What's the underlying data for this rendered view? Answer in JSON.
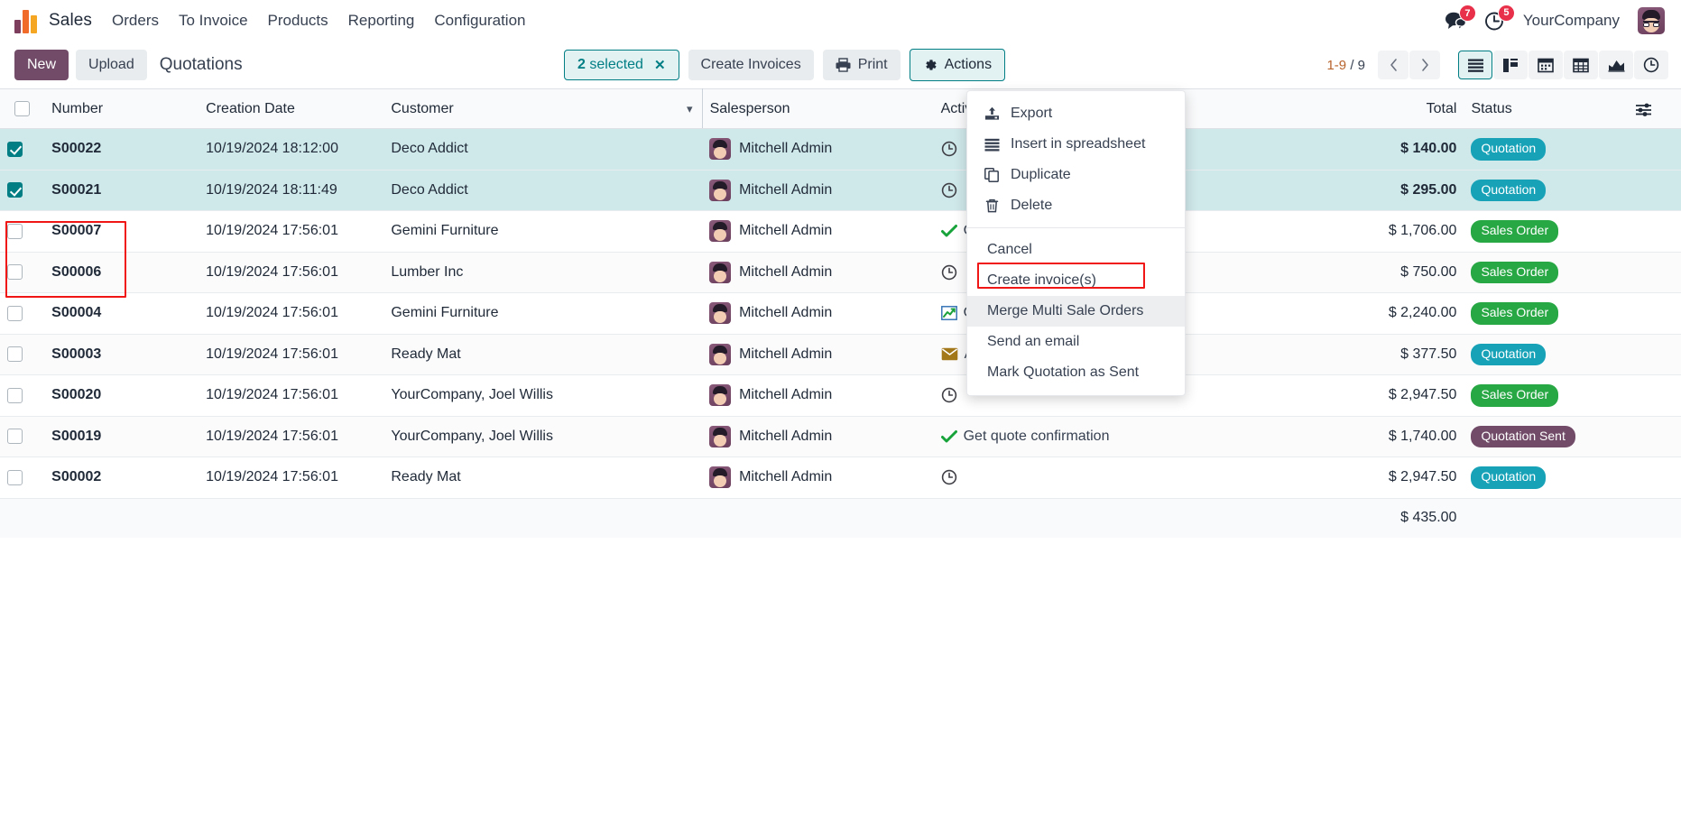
{
  "navbar": {
    "brand": "brand-logo",
    "app_name": "Sales",
    "menu": [
      "Orders",
      "To Invoice",
      "Products",
      "Reporting",
      "Configuration"
    ],
    "messages_count": "7",
    "activities_count": "5",
    "company": "YourCompany"
  },
  "control_panel": {
    "new_label": "New",
    "upload_label": "Upload",
    "view_title": "Quotations",
    "selection": {
      "count": "2",
      "label": "selected",
      "clear": "✕"
    },
    "create_invoices_label": "Create Invoices",
    "print_label": "Print",
    "actions_label": "Actions",
    "pager": {
      "range": "1-9",
      "sep": "/",
      "total": "9"
    },
    "views": [
      {
        "name": "list",
        "active": true
      },
      {
        "name": "kanban",
        "active": false
      },
      {
        "name": "calendar",
        "active": false
      },
      {
        "name": "pivot",
        "active": false
      },
      {
        "name": "graph",
        "active": false
      },
      {
        "name": "activity",
        "active": false
      }
    ]
  },
  "actions_menu": {
    "group1": [
      {
        "label": "Export",
        "icon": "export-icon"
      },
      {
        "label": "Insert in spreadsheet",
        "icon": "spreadsheet-icon"
      },
      {
        "label": "Duplicate",
        "icon": "duplicate-icon"
      },
      {
        "label": "Delete",
        "icon": "trash-icon"
      }
    ],
    "group2": [
      {
        "label": "Cancel",
        "highlighted": false
      },
      {
        "label": "Create invoice(s)",
        "highlighted": false
      },
      {
        "label": "Merge Multi Sale Orders",
        "highlighted": true
      },
      {
        "label": "Send an email",
        "highlighted": false
      },
      {
        "label": "Mark Quotation as Sent",
        "highlighted": false
      }
    ]
  },
  "table": {
    "columns": [
      "Number",
      "Creation Date",
      "Customer",
      "Salesperson",
      "Activities",
      "Total",
      "Status"
    ],
    "rows": [
      {
        "number": "S00022",
        "date": "10/19/2024 18:12:00",
        "customer": "Deco Addict",
        "salesperson": "Mitchell Admin",
        "activity": "",
        "activity_icon": "clock-icon",
        "total": "$ 140.00",
        "status": "Quotation",
        "status_kind": "quotation",
        "selected": true
      },
      {
        "number": "S00021",
        "date": "10/19/2024 18:11:49",
        "customer": "Deco Addict",
        "salesperson": "Mitchell Admin",
        "activity": "",
        "activity_icon": "clock-icon",
        "total": "$ 295.00",
        "status": "Quotation",
        "status_kind": "quotation",
        "selected": true
      },
      {
        "number": "S00007",
        "date": "10/19/2024 17:56:01",
        "customer": "Gemini Furniture",
        "salesperson": "Mitchell Admin",
        "activity": "Ch",
        "activity_icon": "check-icon",
        "total": "$ 1,706.00",
        "status": "Sales Order",
        "status_kind": "sales",
        "selected": false
      },
      {
        "number": "S00006",
        "date": "10/19/2024 17:56:01",
        "customer": "Lumber Inc",
        "salesperson": "Mitchell Admin",
        "activity": "",
        "activity_icon": "clock-icon",
        "total": "$ 750.00",
        "status": "Sales Order",
        "status_kind": "sales",
        "selected": false
      },
      {
        "number": "S00004",
        "date": "10/19/2024 17:56:01",
        "customer": "Gemini Furniture",
        "salesperson": "Mitchell Admin",
        "activity": "Or",
        "activity_icon": "chart-icon",
        "total": "$ 2,240.00",
        "status": "Sales Order",
        "status_kind": "sales",
        "selected": false
      },
      {
        "number": "S00003",
        "date": "10/19/2024 17:56:01",
        "customer": "Ready Mat",
        "salesperson": "Mitchell Admin",
        "activity": "Answer questions",
        "activity_icon": "envelope-icon",
        "total": "$ 377.50",
        "status": "Quotation",
        "status_kind": "quotation",
        "selected": false
      },
      {
        "number": "S00020",
        "date": "10/19/2024 17:56:01",
        "customer": "YourCompany, Joel Willis",
        "salesperson": "Mitchell Admin",
        "activity": "",
        "activity_icon": "clock-icon",
        "total": "$ 2,947.50",
        "status": "Sales Order",
        "status_kind": "sales",
        "selected": false
      },
      {
        "number": "S00019",
        "date": "10/19/2024 17:56:01",
        "customer": "YourCompany, Joel Willis",
        "salesperson": "Mitchell Admin",
        "activity": "Get quote confirmation",
        "activity_icon": "check-icon",
        "total": "$ 1,740.00",
        "status": "Quotation Sent",
        "status_kind": "qsent",
        "selected": false
      },
      {
        "number": "S00002",
        "date": "10/19/2024 17:56:01",
        "customer": "Ready Mat",
        "salesperson": "Mitchell Admin",
        "activity": "",
        "activity_icon": "clock-icon",
        "total": "$ 2,947.50",
        "status": "Quotation",
        "status_kind": "quotation",
        "selected": false
      }
    ],
    "footer_total": "$ 435.00"
  },
  "colors": {
    "accent_teal": "#017e84",
    "brand_purple": "#714b67",
    "badge_red": "#e8304a",
    "quotation": "#17a2b8",
    "sales_order": "#28a745",
    "quotation_sent": "#714b67",
    "annotation": "#f01616"
  }
}
